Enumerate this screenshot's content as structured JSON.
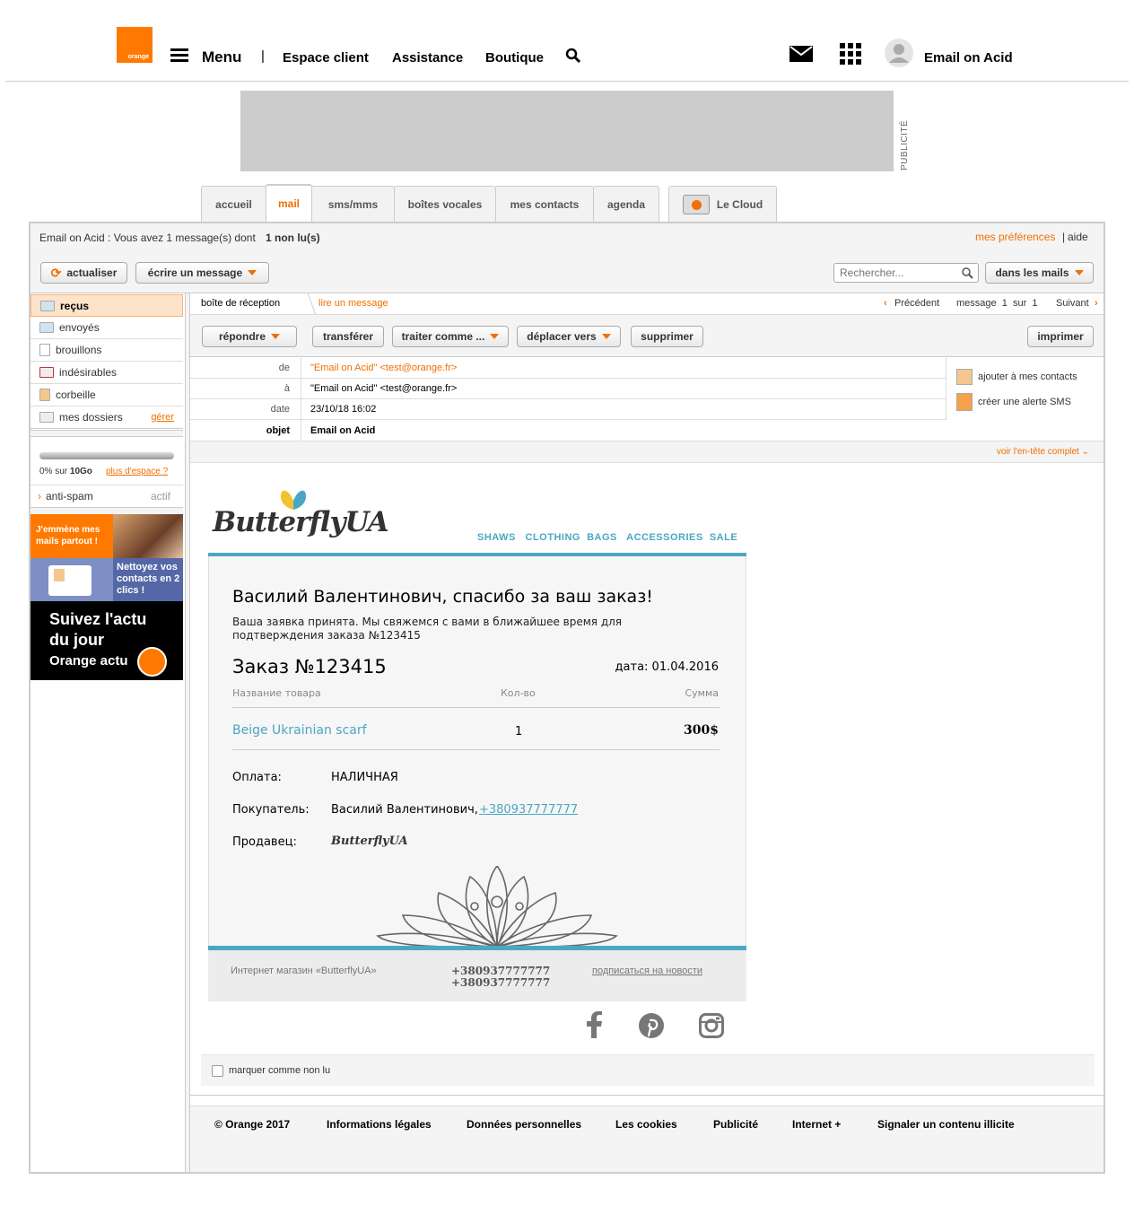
{
  "header": {
    "logo_text": "orange",
    "menu_label": "Menu",
    "separator": "|",
    "nav": [
      "Espace client",
      "Assistance",
      "Boutique"
    ],
    "user_name": "Email on Acid"
  },
  "ad": {
    "label": "PUBLICITÉ"
  },
  "tabs": [
    "accueil",
    "mail",
    "sms/mms",
    "boîtes vocales",
    "mes contacts",
    "agenda",
    "Le Cloud"
  ],
  "status": {
    "prefix": "Email on Acid : Vous avez 1 message(s) dont",
    "unread": "1 non lu(s)",
    "prefs": "mes préférences",
    "sep": "|",
    "help": "aide"
  },
  "toolbar": {
    "refresh": "actualiser",
    "compose": "écrire un message",
    "search_placeholder": "Rechercher...",
    "scope": "dans les mails"
  },
  "sidebar": {
    "folders": [
      "reçus",
      "envoyés",
      "brouillons",
      "indésirables",
      "corbeille",
      "mes dossiers"
    ],
    "manage": "gérer",
    "quota": "0% sur",
    "quota_size": "10Go",
    "more_space": "plus d'espace ?",
    "antispam": "anti-spam",
    "antispam_state": "actif",
    "promo1": "J'emmène mes mails partout !",
    "promo2": "Nettoyez vos contacts en 2 clics !",
    "promo3_a": "Suivez l'actu",
    "promo3_b": "du jour",
    "promo3_c": "Orange actu"
  },
  "message": {
    "crumb_inbox": "boîte de réception",
    "crumb_read": "lire un message",
    "prev": "Précédent",
    "pager": "message  1  sur  1",
    "next": "Suivant",
    "actions": [
      "répondre",
      "transférer",
      "traiter comme ...",
      "déplacer vers",
      "supprimer",
      "imprimer"
    ],
    "from_label": "de",
    "from": "\"Email on Acid\" <test@orange.fr>",
    "to_label": "à",
    "to": "\"Email on Acid\" <test@orange.fr>",
    "date_label": "date",
    "date": "23/10/18 16:02",
    "subject_label": "objet",
    "subject": "Email on Acid",
    "add_contact": "ajouter à mes contacts",
    "sms_alert": "créer une alerte SMS",
    "full_header": "voir l'en-tête complet",
    "mark_unread": "marquer comme non lu"
  },
  "email": {
    "brand": "ButterflyUA",
    "menu": [
      "SHAWS",
      "CLOTHING",
      "BAGS",
      "ACCESSORIES",
      "SALE"
    ],
    "title": "Василий Валентинович, спасибо за ваш заказ!",
    "intro": "Ваша заявка принята. Мы свяжемся с вами в ближайшее время для подтверждения заказа №123415",
    "order": "Заказ №123415",
    "order_date": "дата: 01.04.2016",
    "col_name": "Название товара",
    "col_qty": "Кол-во",
    "col_sum": "Сумма",
    "item_name": "Beige Ukrainian scarf",
    "item_qty": "1",
    "item_sum": "300$",
    "pay_label": "Оплата:",
    "pay_value": "НАЛИЧНАЯ",
    "buyer_label": "Покупатель:",
    "buyer_value": "Василий Валентинович,",
    "buyer_phone": "+380937777777",
    "seller_label": "Продавец:",
    "shop": "Интернет магазин «ButterflyUA»",
    "phone1": "+380937777777",
    "phone2": "+380937777777",
    "subscribe": "подписаться на новости"
  },
  "footer": [
    "© Orange 2017",
    "Informations légales",
    "Données personnelles",
    "Les cookies",
    "Publicité",
    "Internet +",
    "Signaler un contenu illicite"
  ],
  "colors": {
    "orange": "#ff7900",
    "accent": "#f16e00",
    "teal": "#4aa7c4"
  }
}
